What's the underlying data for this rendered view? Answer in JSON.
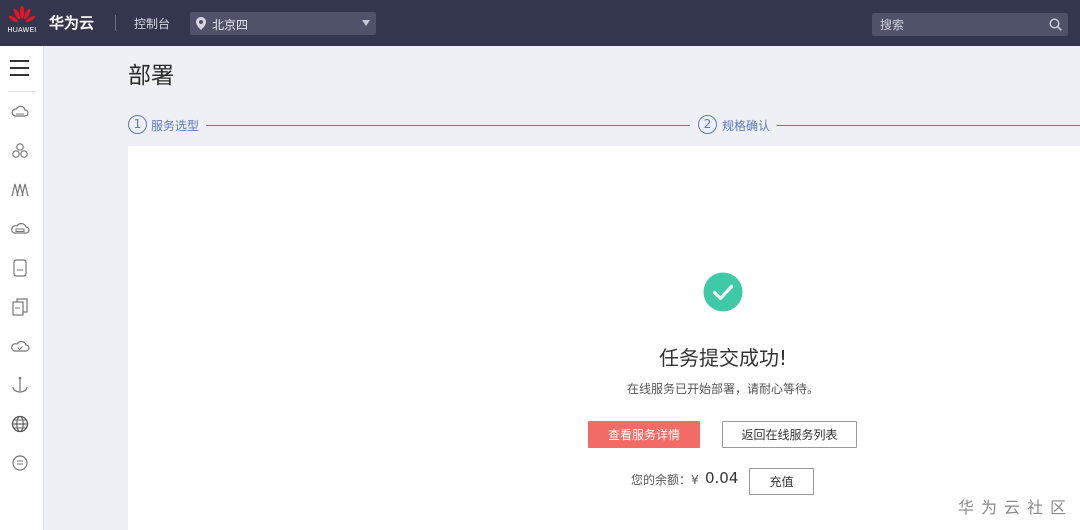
{
  "header": {
    "logo_text": "HUAWEI",
    "brand": "华为云",
    "console": "控制台",
    "region": "北京四",
    "search_placeholder": "搜索"
  },
  "sidebar": {
    "icons": [
      "cloud-server-icon",
      "cluster-icon",
      "model-arts-icon",
      "cloud-storage-icon",
      "document-icon",
      "file-copy-icon",
      "cloud-check-icon",
      "anchor-icon",
      "globe-icon",
      "info-circle-icon"
    ]
  },
  "page": {
    "title": "部署",
    "steps": [
      {
        "num": "1",
        "label": "服务选型"
      },
      {
        "num": "2",
        "label": "规格确认"
      }
    ]
  },
  "result": {
    "headline": "任务提交成功!",
    "subline": "在线服务已开始部署，请耐心等待。",
    "primary_button": "查看服务详情",
    "secondary_button": "返回在线服务列表",
    "balance_label": "您的余额：¥",
    "balance_amount": "0.04",
    "recharge_button": "充值"
  },
  "watermark": "华为云社区",
  "colors": {
    "topbar": "#34364d",
    "accent": "#5b78c9",
    "success": "#3ec9a7",
    "primary_button": "#f26c66"
  }
}
